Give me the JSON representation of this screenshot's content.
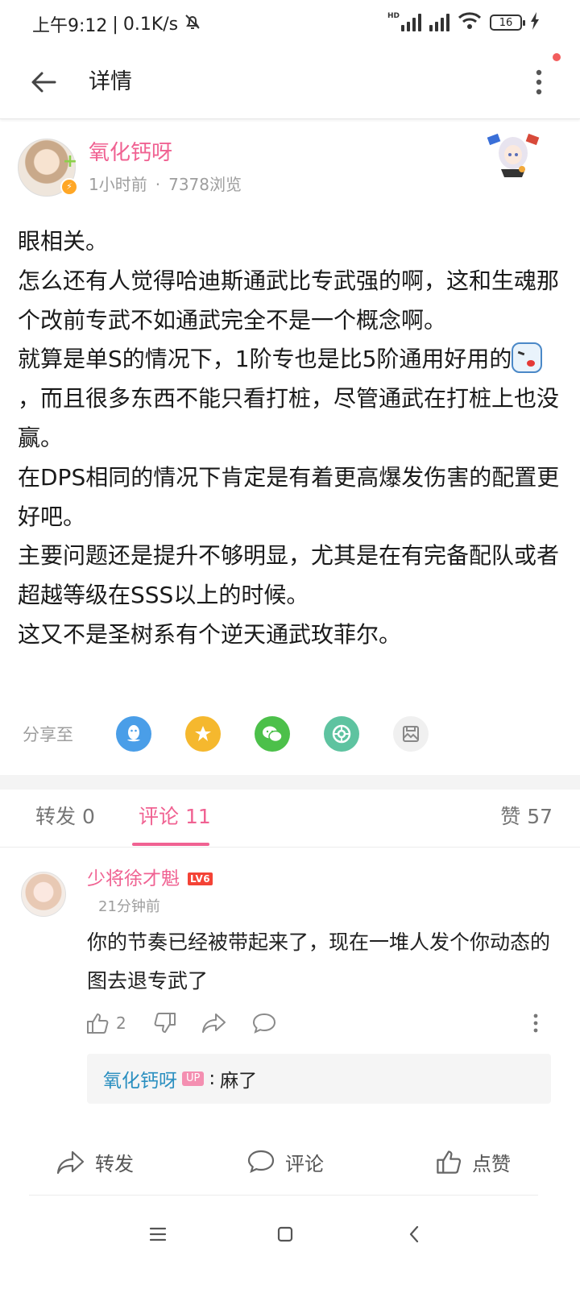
{
  "status_bar": {
    "time": "上午9:12",
    "speed": "0.1K/s",
    "hd_label": "HD",
    "battery": "16"
  },
  "appbar": {
    "title": "详情",
    "back_icon": "arrow-left-icon",
    "more_icon": "more-vertical-icon",
    "notification_dot_color": "#f25d5d"
  },
  "post": {
    "author": "氧化钙呀",
    "time": "1小时前",
    "meta_separator": "·",
    "views": "7378浏览",
    "paragraphs": [
      "眼相关。",
      "怎么还有人觉得哈迪斯通武比专武强的啊，这和生魂那个改前专武不如通武完全不是一个概念啊。",
      "就算是单S的情况下，1阶专也是比5阶通用好用的",
      "，而且很多东西不能只看打桩，尽管通武在打桩上也没赢。",
      "在DPS相同的情况下肯定是有着更高爆发伤害的配置更好吧。",
      "主要问题还是提升不够明显，尤其是在有完备配队或者超越等级在SSS以上的时候。",
      "这又不是圣树系有个逆天通武玫菲尔。"
    ],
    "share": {
      "label": "分享至",
      "targets": [
        {
          "icon": "qq-icon",
          "color": "#4a9ee8"
        },
        {
          "icon": "qzone-star-icon",
          "color": "#f5b82e"
        },
        {
          "icon": "wechat-icon",
          "color": "#4cc04a"
        },
        {
          "icon": "moments-icon",
          "color": "#5ec3a0"
        },
        {
          "icon": "image-share-icon",
          "color": "#f0f0f0"
        }
      ]
    }
  },
  "tabs": {
    "repost": {
      "label": "转发",
      "count": "0"
    },
    "comment": {
      "label": "评论",
      "count": "11"
    },
    "like": {
      "label": "赞",
      "count": "57"
    },
    "accent_color": "#f06292"
  },
  "comment": {
    "author": "少将徐才魁",
    "level": "LV6",
    "time": "21分钟前",
    "text": "你的节奏已经被带起来了，现在一堆人发个你动态的图去退专武了",
    "like_count": "2",
    "reply": {
      "author": "氧化钙呀",
      "tag": "UP",
      "separator": ":",
      "text": "麻了"
    }
  },
  "action_bar": {
    "repost": "转发",
    "comment": "评论",
    "like": "点赞"
  },
  "system_nav": {
    "icons": [
      "menu-icon",
      "home-square-icon",
      "back-chevron-icon"
    ]
  }
}
